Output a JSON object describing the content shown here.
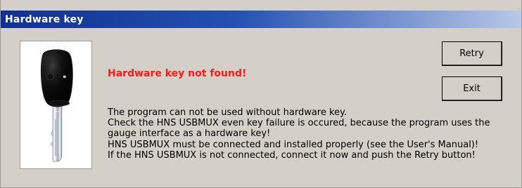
{
  "window": {
    "title": "Hardware key"
  },
  "dialog": {
    "error_message": "Hardware key not found!",
    "message_lines": [
      "The program can not be used without hardware key.",
      "Check the HNS USBMUX even key failure is occured, because the program uses the gauge interface as a hardware key!",
      "HNS USBMUX must be connected and installed properly (see the User's Manual)!",
      "If the HNS USBMUX is not connected, connect it now and push the Retry button!"
    ]
  },
  "buttons": {
    "retry": "Retry",
    "exit": "Exit"
  },
  "icons": {
    "key": "hardware-key-icon"
  },
  "colors": {
    "title_bar_start": "#11318f",
    "title_bar_end": "#b9c8e8",
    "dialog_background": "#d4d0c8",
    "error_text": "#ff1a1a"
  }
}
